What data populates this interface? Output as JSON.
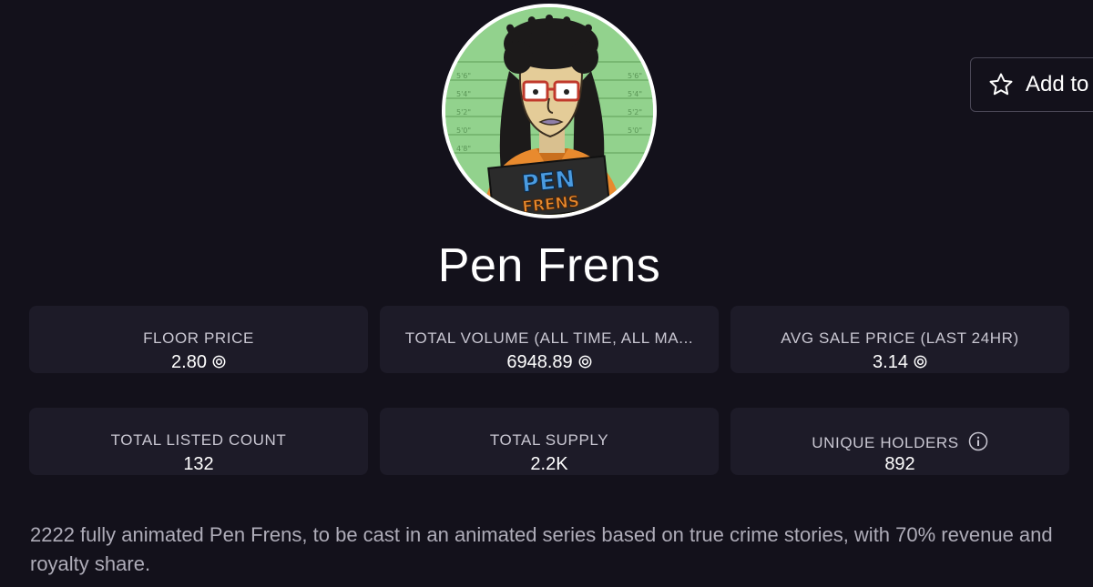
{
  "collection": {
    "name": "Pen Frens",
    "description": "2222 fully animated Pen Frens, to be cast in an animated series based on true crime stories, with 70% revenue and royalty share.",
    "avatar_badge_line1": "PEN",
    "avatar_badge_line2": "FRENS"
  },
  "actions": {
    "add_label": "Add to"
  },
  "stats": [
    {
      "label": "FLOOR PRICE",
      "value": "2.80",
      "currency_icon": "sol-icon"
    },
    {
      "label": "TOTAL VOLUME (ALL TIME, ALL MA...",
      "value": "6948.89",
      "currency_icon": "sol-icon"
    },
    {
      "label": "AVG SALE PRICE (LAST 24HR)",
      "value": "3.14",
      "currency_icon": "sol-icon"
    },
    {
      "label": "TOTAL LISTED COUNT",
      "value": "132"
    },
    {
      "label": "TOTAL SUPPLY",
      "value": "2.2K"
    },
    {
      "label": "UNIQUE HOLDERS",
      "value": "892",
      "info_icon": "info-icon"
    }
  ],
  "colors": {
    "background": "#13111b",
    "card": "#1d1b28",
    "text_primary": "#ffffff",
    "text_muted": "#aeacb8"
  }
}
